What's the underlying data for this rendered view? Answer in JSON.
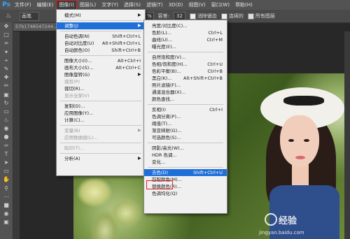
{
  "app": {
    "logo": "Ps"
  },
  "menubar": {
    "items": [
      "文件(F)",
      "编辑(E)",
      "图像(I)",
      "图层(L)",
      "文字(Y)",
      "选择(S)",
      "滤镜(T)",
      "3D(D)",
      "视图(V)",
      "窗口(W)",
      "帮助(H)"
    ],
    "active_index": 2
  },
  "options": {
    "mode_label": "画笔",
    "pct": "%",
    "tolerance_label": "容差:",
    "tolerance_value": "32",
    "antialias_label": "消除锯齿",
    "contiguous_label": "连续的",
    "all_layers_label": "所有图层"
  },
  "document": {
    "tab_title": "57b1748547244..."
  },
  "image_menu": [
    {
      "label": "模式(M)",
      "shortcut": "",
      "submenu": true,
      "disabled": false
    },
    {
      "sep": true
    },
    {
      "label": "调整(J)",
      "shortcut": "",
      "submenu": true,
      "disabled": false,
      "highlight": true
    },
    {
      "sep": true
    },
    {
      "label": "自动色调(N)",
      "shortcut": "Shift+Ctrl+L",
      "disabled": false
    },
    {
      "label": "自动对比度(U)",
      "shortcut": "Alt+Shift+Ctrl+L",
      "disabled": false
    },
    {
      "label": "自动颜色(O)",
      "shortcut": "Shift+Ctrl+B",
      "disabled": false
    },
    {
      "sep": true
    },
    {
      "label": "图像大小(I)...",
      "shortcut": "Alt+Ctrl+I",
      "disabled": false
    },
    {
      "label": "画布大小(S)...",
      "shortcut": "Alt+Ctrl+C",
      "disabled": false
    },
    {
      "label": "图像旋转(G)",
      "shortcut": "",
      "submenu": true,
      "disabled": false
    },
    {
      "label": "裁剪(P)",
      "shortcut": "",
      "disabled": true
    },
    {
      "label": "裁切(R)...",
      "shortcut": "",
      "disabled": false
    },
    {
      "label": "显示全部(V)",
      "shortcut": "",
      "disabled": true
    },
    {
      "sep": true
    },
    {
      "label": "复制(D)...",
      "shortcut": "",
      "disabled": false
    },
    {
      "label": "应用图像(Y)...",
      "shortcut": "",
      "disabled": false
    },
    {
      "label": "计算(C)...",
      "shortcut": "",
      "disabled": false
    },
    {
      "sep": true
    },
    {
      "label": "变量(B)",
      "shortcut": "",
      "submenu": true,
      "disabled": true
    },
    {
      "label": "应用数据组(L)...",
      "shortcut": "",
      "disabled": true
    },
    {
      "sep": true
    },
    {
      "label": "陷印(T)...",
      "shortcut": "",
      "disabled": true
    },
    {
      "sep": true
    },
    {
      "label": "分析(A)",
      "shortcut": "",
      "submenu": true,
      "disabled": false
    }
  ],
  "adjust_menu": [
    {
      "label": "亮度/对比度(C)...",
      "shortcut": ""
    },
    {
      "label": "色阶(L)...",
      "shortcut": "Ctrl+L"
    },
    {
      "label": "曲线(U)...",
      "shortcut": "Ctrl+M"
    },
    {
      "label": "曝光度(E)...",
      "shortcut": ""
    },
    {
      "sep": true
    },
    {
      "label": "自然饱和度(V)...",
      "shortcut": ""
    },
    {
      "label": "色相/饱和度(H)...",
      "shortcut": "Ctrl+U"
    },
    {
      "label": "色彩平衡(B)...",
      "shortcut": "Ctrl+B"
    },
    {
      "label": "黑白(K)...",
      "shortcut": "Alt+Shift+Ctrl+B"
    },
    {
      "label": "照片滤镜(F)...",
      "shortcut": ""
    },
    {
      "label": "通道混合器(X)...",
      "shortcut": ""
    },
    {
      "label": "颜色查找...",
      "shortcut": ""
    },
    {
      "sep": true
    },
    {
      "label": "反相(I)",
      "shortcut": "Ctrl+I"
    },
    {
      "label": "色调分离(P)...",
      "shortcut": ""
    },
    {
      "label": "阈值(T)...",
      "shortcut": ""
    },
    {
      "label": "渐变映射(G)...",
      "shortcut": ""
    },
    {
      "label": "可选颜色(S)...",
      "shortcut": ""
    },
    {
      "sep": true
    },
    {
      "label": "阴影/高光(W)...",
      "shortcut": ""
    },
    {
      "label": "HDR 色调...",
      "shortcut": ""
    },
    {
      "label": "变化...",
      "shortcut": ""
    },
    {
      "sep": true
    },
    {
      "label": "去色(D)",
      "shortcut": "Shift+Ctrl+U",
      "highlight": true
    },
    {
      "label": "匹配颜色(M)...",
      "shortcut": ""
    },
    {
      "label": "替换颜色(R)...",
      "shortcut": ""
    },
    {
      "label": "色调均化(Q)",
      "shortcut": ""
    }
  ],
  "watermark": {
    "brand": "经验",
    "url": "jingyan.baidu.com"
  }
}
